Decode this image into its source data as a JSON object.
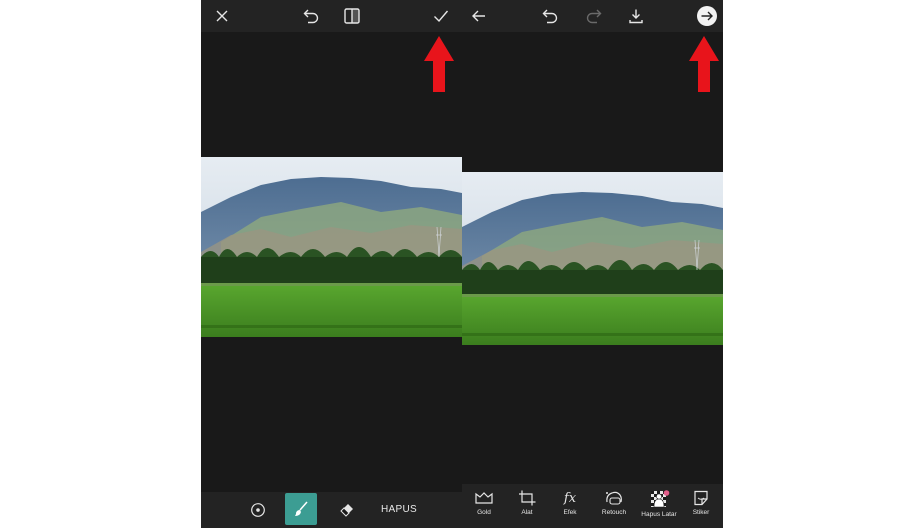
{
  "left_editor": {
    "bottom_toolbar": {
      "erase_all_label": "HAPUS"
    }
  },
  "right_editor": {
    "tools": [
      {
        "label": "Gold",
        "icon": "gold-icon"
      },
      {
        "label": "Alat",
        "icon": "crop-icon"
      },
      {
        "label": "Efek",
        "icon": "fx-icon"
      },
      {
        "label": "Retouch",
        "icon": "retouch-icon"
      },
      {
        "label": "Hapus Latar",
        "icon": "remove-bg-icon"
      },
      {
        "label": "Stiker",
        "icon": "sticker-icon"
      }
    ]
  },
  "colors": {
    "annotation_arrow": "#e8141b",
    "brush_active": "#3c9d93",
    "panel_bg": "#191919",
    "bar_bg": "#232323"
  }
}
